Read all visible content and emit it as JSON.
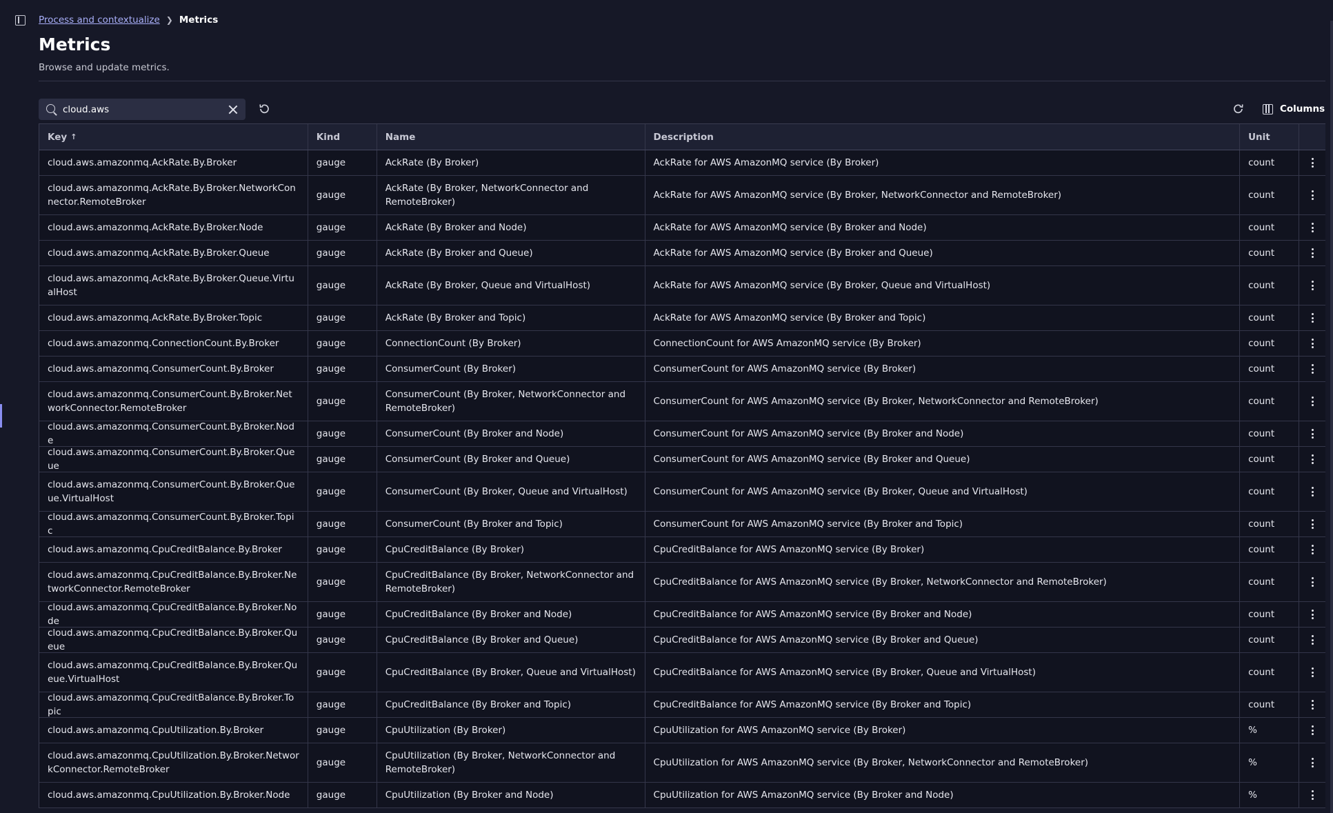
{
  "breadcrumb": {
    "parent": "Process and contextualize",
    "current": "Metrics"
  },
  "page": {
    "title": "Metrics",
    "subtitle": "Browse and update metrics."
  },
  "toolbar": {
    "search_value": "cloud.aws",
    "columns_label": "Columns"
  },
  "table": {
    "headers": {
      "key": "Key",
      "kind": "Kind",
      "name": "Name",
      "description": "Description",
      "unit": "Unit"
    },
    "sort": {
      "column": "key",
      "direction": "ascending"
    },
    "rows": [
      {
        "key": "cloud.aws.amazonmq.AckRate.By.Broker",
        "kind": "gauge",
        "name": "AckRate (By Broker)",
        "description": "AckRate for AWS AmazonMQ service (By Broker)",
        "unit": "count"
      },
      {
        "key": "cloud.aws.amazonmq.AckRate.By.Broker.NetworkConnector.RemoteBroker",
        "kind": "gauge",
        "name": "AckRate (By Broker, NetworkConnector and RemoteBroker)",
        "description": "AckRate for AWS AmazonMQ service (By Broker, NetworkConnector and RemoteBroker)",
        "unit": "count"
      },
      {
        "key": "cloud.aws.amazonmq.AckRate.By.Broker.Node",
        "kind": "gauge",
        "name": "AckRate (By Broker and Node)",
        "description": "AckRate for AWS AmazonMQ service (By Broker and Node)",
        "unit": "count"
      },
      {
        "key": "cloud.aws.amazonmq.AckRate.By.Broker.Queue",
        "kind": "gauge",
        "name": "AckRate (By Broker and Queue)",
        "description": "AckRate for AWS AmazonMQ service (By Broker and Queue)",
        "unit": "count"
      },
      {
        "key": "cloud.aws.amazonmq.AckRate.By.Broker.Queue.VirtualHost",
        "kind": "gauge",
        "name": "AckRate (By Broker, Queue and VirtualHost)",
        "description": "AckRate for AWS AmazonMQ service (By Broker, Queue and VirtualHost)",
        "unit": "count"
      },
      {
        "key": "cloud.aws.amazonmq.AckRate.By.Broker.Topic",
        "kind": "gauge",
        "name": "AckRate (By Broker and Topic)",
        "description": "AckRate for AWS AmazonMQ service (By Broker and Topic)",
        "unit": "count"
      },
      {
        "key": "cloud.aws.amazonmq.ConnectionCount.By.Broker",
        "kind": "gauge",
        "name": "ConnectionCount (By Broker)",
        "description": "ConnectionCount for AWS AmazonMQ service (By Broker)",
        "unit": "count"
      },
      {
        "key": "cloud.aws.amazonmq.ConsumerCount.By.Broker",
        "kind": "gauge",
        "name": "ConsumerCount (By Broker)",
        "description": "ConsumerCount for AWS AmazonMQ service (By Broker)",
        "unit": "count"
      },
      {
        "key": "cloud.aws.amazonmq.ConsumerCount.By.Broker.NetworkConnector.RemoteBroker",
        "kind": "gauge",
        "name": "ConsumerCount (By Broker, NetworkConnector and RemoteBroker)",
        "description": "ConsumerCount for AWS AmazonMQ service (By Broker, NetworkConnector and RemoteBroker)",
        "unit": "count"
      },
      {
        "key": "cloud.aws.amazonmq.ConsumerCount.By.Broker.Node",
        "kind": "gauge",
        "name": "ConsumerCount (By Broker and Node)",
        "description": "ConsumerCount for AWS AmazonMQ service (By Broker and Node)",
        "unit": "count"
      },
      {
        "key": "cloud.aws.amazonmq.ConsumerCount.By.Broker.Queue",
        "kind": "gauge",
        "name": "ConsumerCount (By Broker and Queue)",
        "description": "ConsumerCount for AWS AmazonMQ service (By Broker and Queue)",
        "unit": "count"
      },
      {
        "key": "cloud.aws.amazonmq.ConsumerCount.By.Broker.Queue.VirtualHost",
        "kind": "gauge",
        "name": "ConsumerCount (By Broker, Queue and VirtualHost)",
        "description": "ConsumerCount for AWS AmazonMQ service (By Broker, Queue and VirtualHost)",
        "unit": "count"
      },
      {
        "key": "cloud.aws.amazonmq.ConsumerCount.By.Broker.Topic",
        "kind": "gauge",
        "name": "ConsumerCount (By Broker and Topic)",
        "description": "ConsumerCount for AWS AmazonMQ service (By Broker and Topic)",
        "unit": "count"
      },
      {
        "key": "cloud.aws.amazonmq.CpuCreditBalance.By.Broker",
        "kind": "gauge",
        "name": "CpuCreditBalance (By Broker)",
        "description": "CpuCreditBalance for AWS AmazonMQ service (By Broker)",
        "unit": "count"
      },
      {
        "key": "cloud.aws.amazonmq.CpuCreditBalance.By.Broker.NetworkConnector.RemoteBroker",
        "kind": "gauge",
        "name": "CpuCreditBalance (By Broker, NetworkConnector and RemoteBroker)",
        "description": "CpuCreditBalance for AWS AmazonMQ service (By Broker, NetworkConnector and RemoteBroker)",
        "unit": "count"
      },
      {
        "key": "cloud.aws.amazonmq.CpuCreditBalance.By.Broker.Node",
        "kind": "gauge",
        "name": "CpuCreditBalance (By Broker and Node)",
        "description": "CpuCreditBalance for AWS AmazonMQ service (By Broker and Node)",
        "unit": "count"
      },
      {
        "key": "cloud.aws.amazonmq.CpuCreditBalance.By.Broker.Queue",
        "kind": "gauge",
        "name": "CpuCreditBalance (By Broker and Queue)",
        "description": "CpuCreditBalance for AWS AmazonMQ service (By Broker and Queue)",
        "unit": "count"
      },
      {
        "key": "cloud.aws.amazonmq.CpuCreditBalance.By.Broker.Queue.VirtualHost",
        "kind": "gauge",
        "name": "CpuCreditBalance (By Broker, Queue and VirtualHost)",
        "description": "CpuCreditBalance for AWS AmazonMQ service (By Broker, Queue and VirtualHost)",
        "unit": "count"
      },
      {
        "key": "cloud.aws.amazonmq.CpuCreditBalance.By.Broker.Topic",
        "kind": "gauge",
        "name": "CpuCreditBalance (By Broker and Topic)",
        "description": "CpuCreditBalance for AWS AmazonMQ service (By Broker and Topic)",
        "unit": "count"
      },
      {
        "key": "cloud.aws.amazonmq.CpuUtilization.By.Broker",
        "kind": "gauge",
        "name": "CpuUtilization (By Broker)",
        "description": "CpuUtilization for AWS AmazonMQ service (By Broker)",
        "unit": "%"
      },
      {
        "key": "cloud.aws.amazonmq.CpuUtilization.By.Broker.NetworkConnector.RemoteBroker",
        "kind": "gauge",
        "name": "CpuUtilization (By Broker, NetworkConnector and RemoteBroker)",
        "description": "CpuUtilization for AWS AmazonMQ service (By Broker, NetworkConnector and RemoteBroker)",
        "unit": "%"
      },
      {
        "key": "cloud.aws.amazonmq.CpuUtilization.By.Broker.Node",
        "kind": "gauge",
        "name": "CpuUtilization (By Broker and Node)",
        "description": "CpuUtilization for AWS AmazonMQ service (By Broker and Node)",
        "unit": "%"
      }
    ]
  },
  "icons": {
    "sidebar_toggle": "sidebar-toggle-icon",
    "breadcrumb_separator": "chevron-right-icon",
    "search": "search-icon",
    "clear": "close-icon",
    "reset": "reset-icon",
    "refresh": "refresh-icon",
    "columns": "columns-icon",
    "row_actions": "kebab-menu-icon"
  },
  "colors": {
    "background": "#161827",
    "table_row": "#11131f",
    "link": "#a8aef8",
    "accent": "#8a8ef0"
  }
}
